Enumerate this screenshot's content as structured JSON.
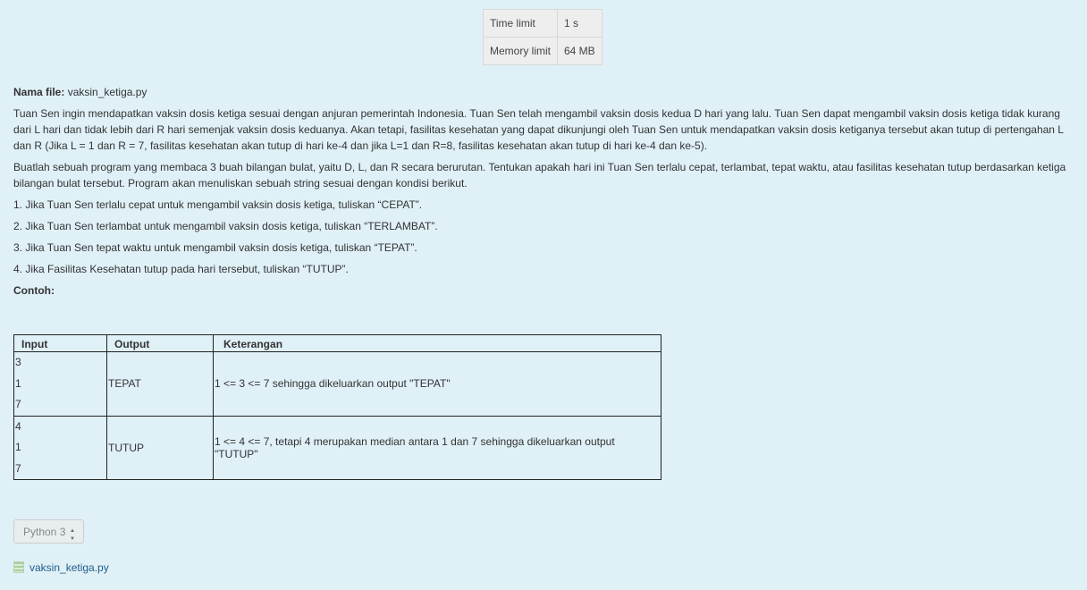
{
  "limits": {
    "time_label": "Time limit",
    "time_value": "1 s",
    "memory_label": "Memory limit",
    "memory_value": "64 MB"
  },
  "problem": {
    "file_label": "Nama file:",
    "file_name": "vaksin_ketiga.py",
    "para1": "Tuan Sen ingin mendapatkan vaksin dosis ketiga sesuai dengan anjuran pemerintah Indonesia. Tuan Sen telah mengambil vaksin dosis kedua D hari yang lalu. Tuan Sen dapat mengambil vaksin dosis ketiga tidak kurang dari L hari dan tidak lebih dari R hari semenjak vaksin dosis keduanya. Akan tetapi, fasilitas kesehatan yang dapat dikunjungi oleh Tuan Sen untuk mendapatkan vaksin dosis ketiganya tersebut akan tutup di pertengahan L dan R (Jika L = 1 dan R = 7, fasilitas kesehatan akan tutup di hari ke-4 dan jika L=1 dan R=8, fasilitas kesehatan akan tutup di hari ke-4 dan ke-5).",
    "para2": "Buatlah sebuah program yang membaca 3 buah bilangan bulat, yaitu D, L, dan R secara berurutan. Tentukan apakah hari ini Tuan Sen terlalu cepat, terlambat, tepat waktu, atau fasilitas kesehatan tutup berdasarkan ketiga bilangan bulat tersebut. Program akan menuliskan sebuah string sesuai dengan kondisi berikut.",
    "rules": [
      "1. Jika Tuan Sen terlalu cepat untuk mengambil vaksin dosis ketiga, tuliskan “CEPAT”.",
      "2. Jika Tuan Sen terlambat untuk mengambil vaksin dosis ketiga, tuliskan “TERLAMBAT”.",
      "3. Jika Tuan Sen tepat waktu untuk mengambil vaksin dosis ketiga, tuliskan “TEPAT”.",
      "4. Jika Fasilitas Kesehatan tutup pada hari tersebut, tuliskan “TUTUP”."
    ],
    "examples_label": "Contoh:"
  },
  "examples": {
    "headers": [
      "Input",
      "Output",
      "Keterangan"
    ],
    "rows": [
      {
        "input": [
          "3",
          "1",
          "7"
        ],
        "output": "TEPAT",
        "note": "1 <= 3 <= 7 sehingga dikeluarkan output \"TEPAT\""
      },
      {
        "input": [
          "4",
          "1",
          "7"
        ],
        "output": "TUTUP",
        "note": "1 <= 4 <= 7, tetapi 4 merupakan median antara 1 dan 7 sehingga dikeluarkan output \"TUTUP\""
      }
    ]
  },
  "language_select": {
    "value": "Python 3"
  },
  "attachment": {
    "name": "vaksin_ketiga.py",
    "icon": "file-icon"
  }
}
